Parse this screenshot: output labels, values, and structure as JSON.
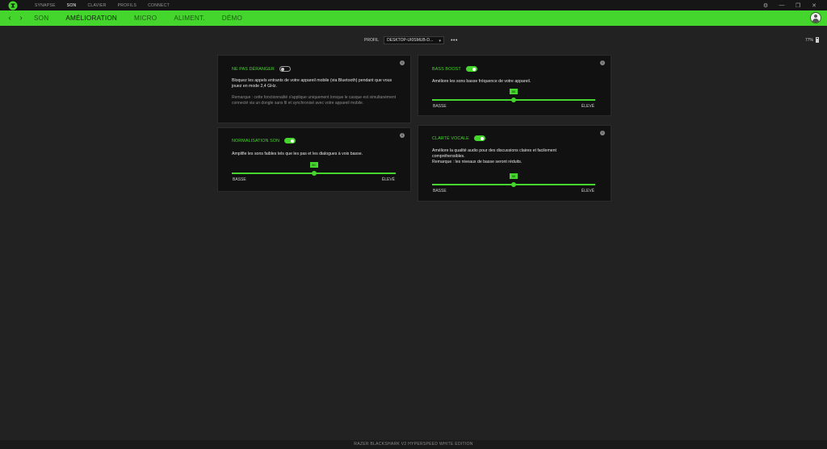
{
  "topnav": {
    "items": [
      "SYNAPSE",
      "SON",
      "CLAVIER",
      "PROFILS",
      "CONNECT"
    ],
    "active_index": 1
  },
  "window_controls": [
    "⚙",
    "—",
    "❐",
    "✕"
  ],
  "subnav": {
    "tabs": [
      "SON",
      "AMÉLIORATION",
      "MICRO",
      "ALIMENT.",
      "DÉMO"
    ],
    "active_index": 1
  },
  "profile": {
    "label": "PROFIL",
    "value": "DESKTOP-UI0SMUB-D...",
    "more": "•••"
  },
  "battery": {
    "percent": "77%"
  },
  "cards": {
    "dnd": {
      "title": "NE PAS DÉRANGER",
      "enabled": false,
      "text": "Bloquez les appels entrants de votre appareil mobile (via Bluetooth) pendant que vous jouez en mode 2,4 GHz.",
      "note": "Remarque : cette fonctionnalité s'applique uniquement lorsque le casque est simultanément connecté via un dongle sans fil et synchronisé avec votre appareil mobile."
    },
    "normalisation": {
      "title": "NORMALISATION SON",
      "enabled": true,
      "text": "Amplifie les sons faibles tels que les pas et les dialogues à voix basse.",
      "slider": {
        "value_label": "50",
        "value": 0.5,
        "min_label": "BASSE",
        "max_label": "ÉLEVÉ"
      }
    },
    "bass": {
      "title": "BASS BOOST",
      "enabled": true,
      "text": "Améliore les sons basse fréquence de votre appareil.",
      "slider": {
        "value_label": "50",
        "value": 0.5,
        "min_label": "BASSE",
        "max_label": "ÉLEVÉ"
      }
    },
    "clarity": {
      "title": "CLARTÉ VOCALE",
      "enabled": true,
      "text": "Améliore la qualité audio pour des discussions claires et facilement compréhensibles.",
      "text2": "Remarque : les niveaux de basse seront réduits.",
      "slider": {
        "value_label": "50",
        "value": 0.5,
        "min_label": "BASSE",
        "max_label": "ÉLEVÉ"
      }
    }
  },
  "footer": {
    "device": "RAZER BLACKSHARK V2 HYPERSPEED WHITE EDITION"
  },
  "colors": {
    "accent": "#44d62c",
    "background": "#222222",
    "card": "#111111"
  }
}
